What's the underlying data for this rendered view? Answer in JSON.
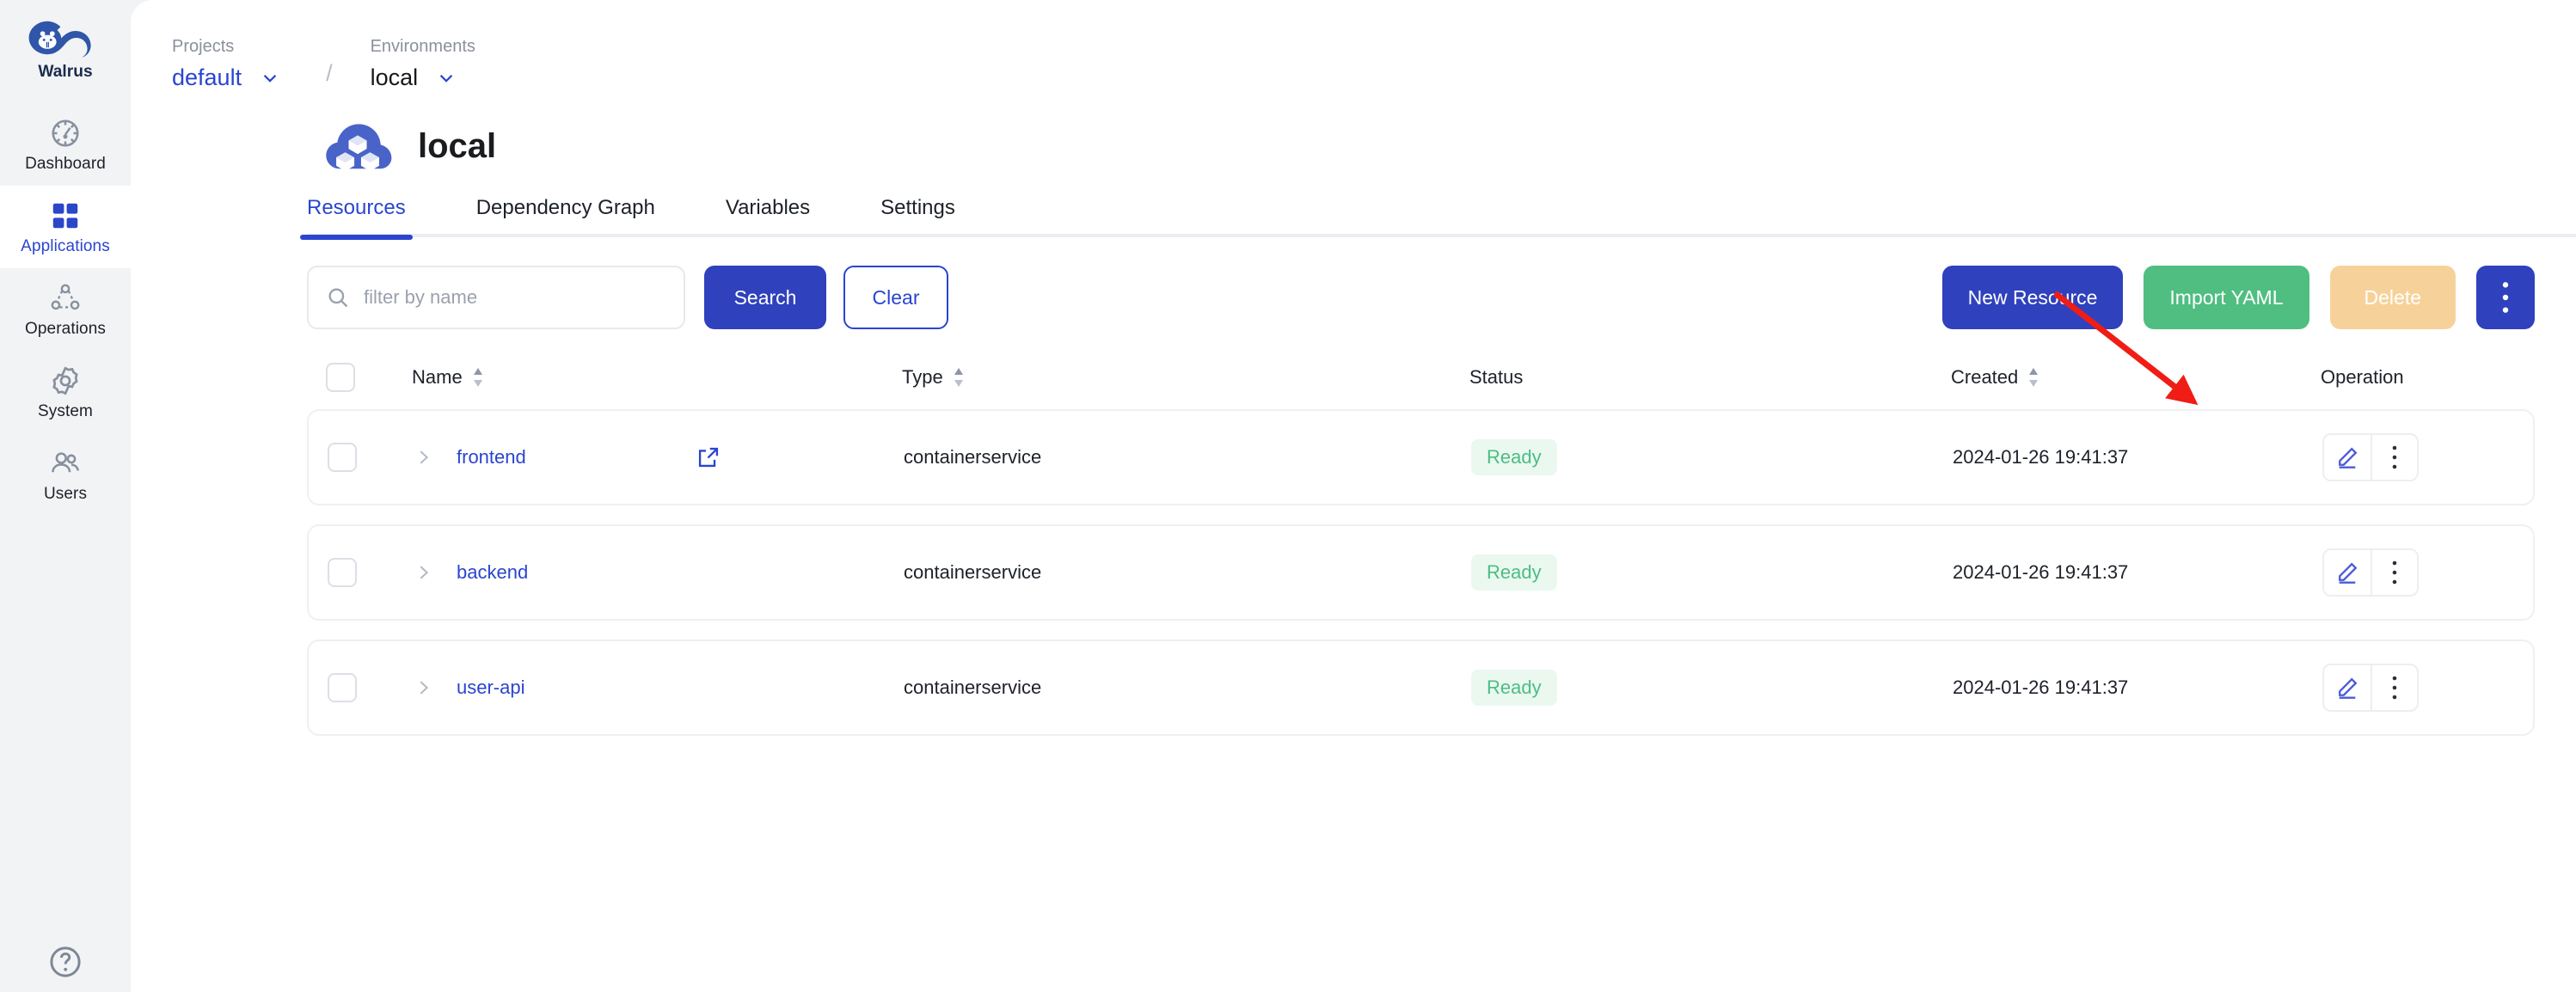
{
  "brand": {
    "name": "Walrus",
    "logo_icon": "walrus-logo-icon"
  },
  "sidebar": {
    "items": [
      {
        "label": "Dashboard",
        "icon": "dashboard-icon",
        "active": false
      },
      {
        "label": "Applications",
        "icon": "applications-icon",
        "active": true
      },
      {
        "label": "Operations",
        "icon": "operations-icon",
        "active": false
      },
      {
        "label": "System",
        "icon": "system-gear-icon",
        "active": false
      },
      {
        "label": "Users",
        "icon": "users-icon",
        "active": false
      }
    ],
    "help": {
      "icon": "help-circle-icon"
    }
  },
  "breadcrumb": {
    "projects_label": "Projects",
    "projects_value": "default",
    "separator": "/",
    "environments_label": "Environments",
    "environments_value": "local",
    "chevron_icon": "chevron-down-icon"
  },
  "page": {
    "title": "local",
    "icon": "environment-cloud-icon"
  },
  "tabs": [
    {
      "label": "Resources",
      "active": true
    },
    {
      "label": "Dependency Graph",
      "active": false
    },
    {
      "label": "Variables",
      "active": false
    },
    {
      "label": "Settings",
      "active": false
    }
  ],
  "toolbar": {
    "search_placeholder": "filter by name",
    "search_value": "",
    "search_icon": "search-icon",
    "search_label": "Search",
    "clear_label": "Clear",
    "new_resource_label": "New Resource",
    "import_yaml_label": "Import YAML",
    "delete_label": "Delete",
    "more_icon": "vertical-dots-icon"
  },
  "table": {
    "columns": [
      {
        "key": "name",
        "label": "Name",
        "sortable": true
      },
      {
        "key": "type",
        "label": "Type",
        "sortable": true
      },
      {
        "key": "status",
        "label": "Status",
        "sortable": false
      },
      {
        "key": "created",
        "label": "Created",
        "sortable": true
      },
      {
        "key": "operation",
        "label": "Operation",
        "sortable": false
      }
    ],
    "rows": [
      {
        "name": "frontend",
        "has_external_link": true,
        "type": "containerservice",
        "status": "Ready",
        "created": "2024-01-26 19:41:37"
      },
      {
        "name": "backend",
        "has_external_link": false,
        "type": "containerservice",
        "status": "Ready",
        "created": "2024-01-26 19:41:37"
      },
      {
        "name": "user-api",
        "has_external_link": false,
        "type": "containerservice",
        "status": "Ready",
        "created": "2024-01-26 19:41:37"
      }
    ]
  },
  "annotation": {
    "type": "arrow",
    "color": "#ef1d16",
    "points_to": "import-yaml-button"
  },
  "colors": {
    "primary": "#2f41bc",
    "link": "#2a45cf",
    "success": "#4fbe80",
    "badge_text": "#4dbd83",
    "badge_bg": "#eaf8f0",
    "warning": "#f6d29a",
    "sidebar_bg": "#f2f3f5",
    "annotation_red": "#ef1d16"
  }
}
